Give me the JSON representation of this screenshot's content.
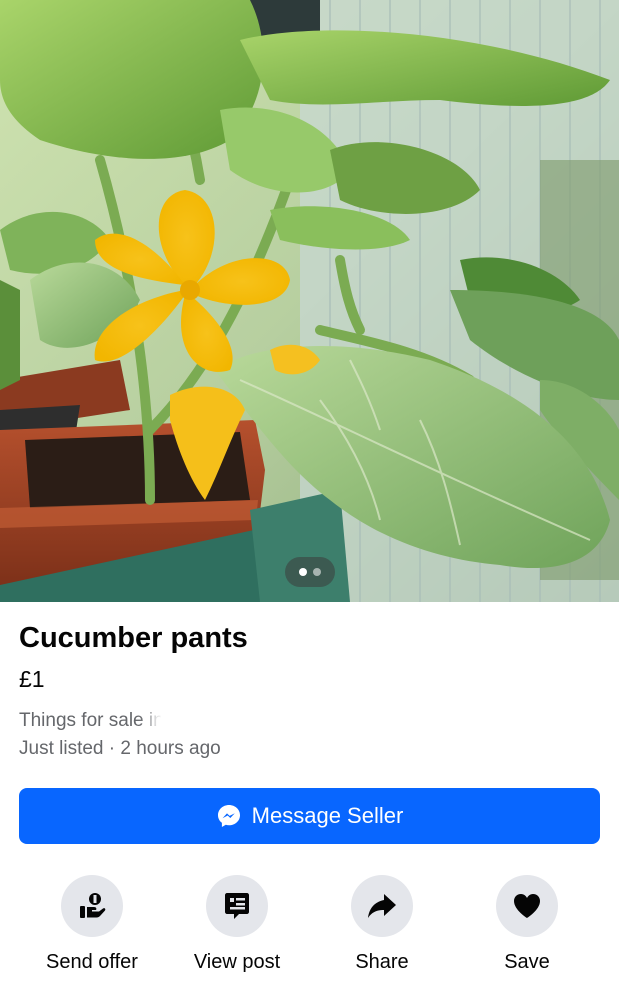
{
  "listing": {
    "title": "Cucumber pants",
    "price": "£1",
    "location_prefix": "Things for sale in",
    "listed_text": "Just listed · 2 hours ago"
  },
  "gallery": {
    "total_images": 2,
    "current_index": 1
  },
  "primary_action": {
    "label": "Message Seller",
    "icon": "messenger-icon",
    "color": "#0866ff"
  },
  "actions": [
    {
      "label": "Send offer",
      "icon": "send-offer-icon"
    },
    {
      "label": "View post",
      "icon": "view-post-icon"
    },
    {
      "label": "Share",
      "icon": "share-icon"
    },
    {
      "label": "Save",
      "icon": "heart-icon"
    }
  ]
}
